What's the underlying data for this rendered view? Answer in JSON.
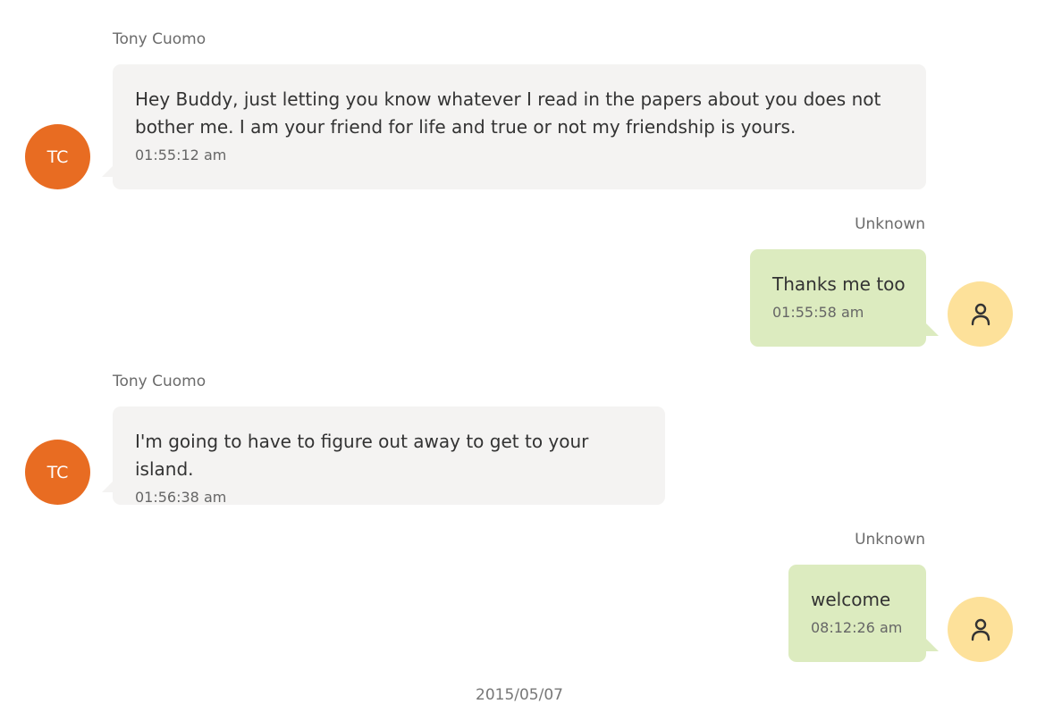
{
  "conversation": {
    "messages": [
      {
        "sender": "Tony Cuomo",
        "initials": "TC",
        "text": "Hey Buddy, just letting you know whatever I read in the papers about you does not bother me.  I am your friend for life and true or not my friendship is yours.",
        "time": "01:55:12 am",
        "direction": "incoming"
      },
      {
        "sender": "Unknown",
        "text": "Thanks me too",
        "time": "01:55:58 am",
        "direction": "outgoing",
        "avatar_icon": "person-icon"
      },
      {
        "sender": "Tony Cuomo",
        "initials": "TC",
        "text": "I'm going to have to figure out away to get to your island.",
        "time": "01:56:38 am",
        "direction": "incoming"
      },
      {
        "sender": "Unknown",
        "text": "welcome",
        "time": "08:12:26 am",
        "direction": "outgoing",
        "avatar_icon": "person-icon"
      }
    ],
    "date_separator": "2015/05/07"
  },
  "colors": {
    "incoming_bubble": "#f4f3f2",
    "outgoing_bubble": "#dcebbf",
    "tc_avatar": "#e86c22",
    "unknown_avatar": "#fde19a"
  }
}
